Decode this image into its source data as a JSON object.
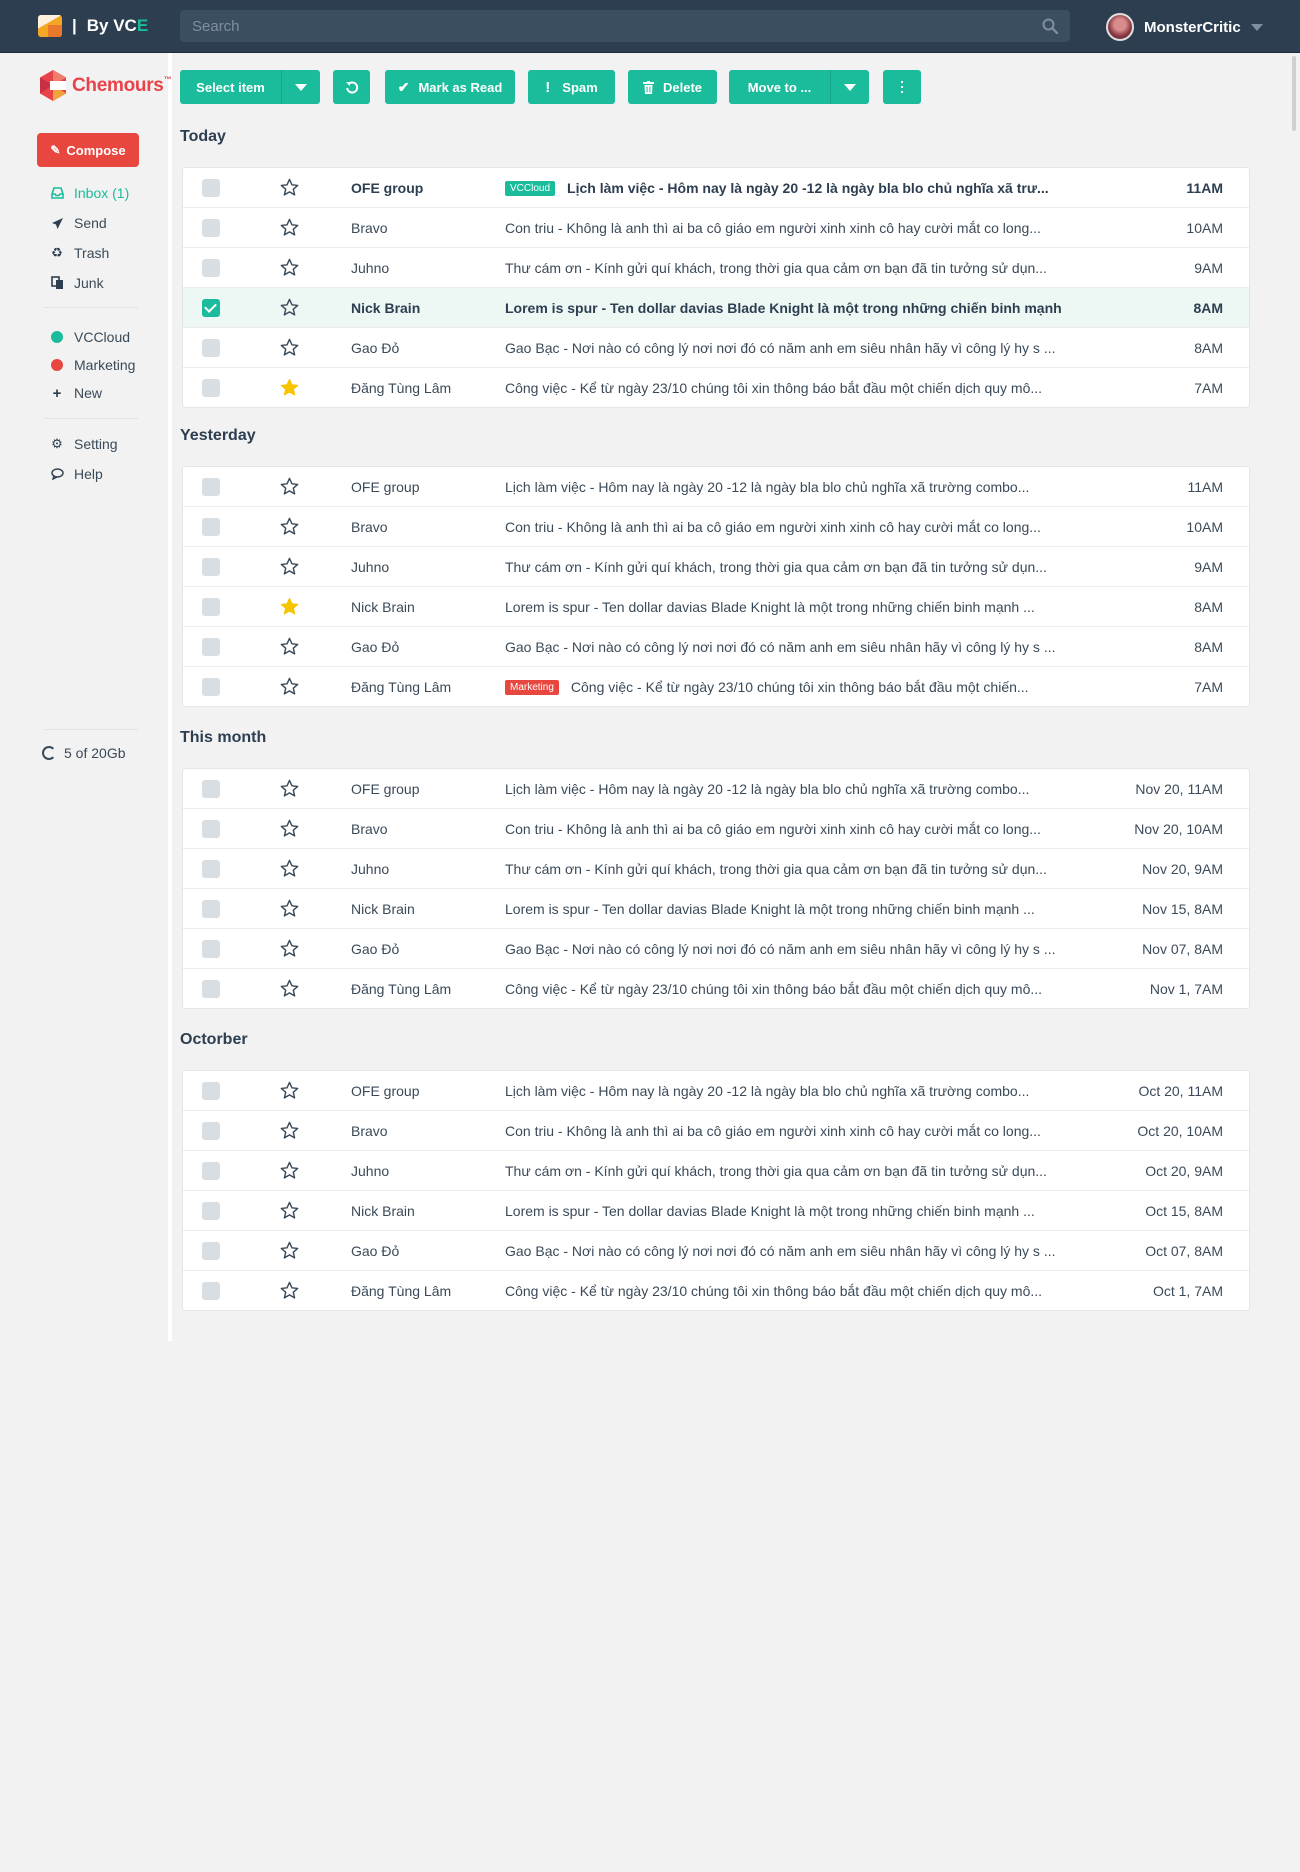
{
  "header": {
    "brand_sep": "|",
    "brand_text": "By VC",
    "brand_accent": "E",
    "search_placeholder": "Search",
    "user_name": "MonsterCritic"
  },
  "sidebar": {
    "brand_name": "Chemours",
    "brand_tm": "™",
    "compose_label": "Compose",
    "folders": [
      {
        "label": "Inbox (1)",
        "icon": "inbox-icon"
      },
      {
        "label": "Send",
        "icon": "send-icon"
      },
      {
        "label": "Trash",
        "icon": "recycle-icon"
      },
      {
        "label": "Junk",
        "icon": "junk-icon"
      }
    ],
    "labels": [
      {
        "label": "VCCloud",
        "color": "#1abc9c"
      },
      {
        "label": "Marketing",
        "color": "#e8473f"
      }
    ],
    "new_label": "New",
    "settings": [
      {
        "label": "Setting",
        "icon": "gear-icon"
      },
      {
        "label": "Help",
        "icon": "chat-icon"
      }
    ],
    "storage": "5 of 20Gb"
  },
  "toolbar": {
    "select_item": "Select item",
    "mark_as_read": "Mark as Read",
    "spam": "Spam",
    "delete": "Delete",
    "move_to": "Move to ..."
  },
  "colors": {
    "accent": "#1abc9c",
    "danger": "#e8473f",
    "topbar": "#2c3e50"
  },
  "groups": [
    {
      "title": "Today",
      "rows": [
        {
          "sender": "OFE group",
          "tag": "VCCloud",
          "tag_color": "#1abc9c",
          "subject": "Lịch làm việc - Hôm nay là ngày  20 -12 là ngày bla blo chủ nghĩa xã trư...",
          "time": "11AM",
          "unread": true,
          "starred": false,
          "checked": false
        },
        {
          "sender": "Bravo",
          "tag": "",
          "subject": "Con triu - Không là anh thì ai ba cô giáo em người xinh xinh cô hay cười mắt co long...",
          "time": "10AM",
          "unread": false,
          "starred": false,
          "checked": false
        },
        {
          "sender": "Juhno",
          "tag": "",
          "subject": "Thư cám ơn - Kính gửi quí khách, trong thời gia qua cảm ơn bạn đã tin tưởng sử dụn...",
          "time": "9AM",
          "unread": false,
          "starred": false,
          "checked": false
        },
        {
          "sender": "Nick Brain",
          "tag": "",
          "subject": "Lorem is spur - Ten dollar davias Blade Knight là một trong những chiến binh mạnh ...",
          "time": "8AM",
          "unread": true,
          "starred": false,
          "checked": true
        },
        {
          "sender": "Gao Đỏ",
          "tag": "",
          "subject": "Gao Bạc - Nơi nào có công lý nơi nơi đó có năm anh em siêu nhân hãy vì công lý hy s ...",
          "time": "8AM",
          "unread": false,
          "starred": false,
          "checked": false
        },
        {
          "sender": "Đăng Tùng Lâm",
          "tag": "",
          "subject": "Công việc - Kể từ ngày 23/10 chúng tôi xin thông báo bắt đầu một chiến dịch quy mô...",
          "time": "7AM",
          "unread": false,
          "starred": true,
          "checked": false
        }
      ]
    },
    {
      "title": "Yesterday",
      "rows": [
        {
          "sender": "OFE group",
          "tag": "",
          "subject": "Lịch làm việc - Hôm nay là ngày  20 -12 là ngày bla blo chủ nghĩa xã trường combo...",
          "time": "11AM",
          "unread": false,
          "starred": false,
          "checked": false
        },
        {
          "sender": "Bravo",
          "tag": "",
          "subject": "Con triu - Không là anh thì ai ba cô giáo em người xinh xinh cô hay cười mắt co long...",
          "time": "10AM",
          "unread": false,
          "starred": false,
          "checked": false
        },
        {
          "sender": "Juhno",
          "tag": "",
          "subject": "Thư cám ơn - Kính gửi quí khách, trong thời gia qua cảm ơn bạn đã tin tưởng sử dụn...",
          "time": "9AM",
          "unread": false,
          "starred": false,
          "checked": false
        },
        {
          "sender": "Nick Brain",
          "tag": "",
          "subject": "Lorem is spur - Ten dollar davias Blade Knight là một trong những chiến binh mạnh ...",
          "time": "8AM",
          "unread": false,
          "starred": true,
          "checked": false
        },
        {
          "sender": "Gao Đỏ",
          "tag": "",
          "subject": "Gao Bạc - Nơi nào có công lý nơi nơi đó có năm anh em siêu nhân hãy vì công lý hy s ...",
          "time": "8AM",
          "unread": false,
          "starred": false,
          "checked": false
        },
        {
          "sender": "Đăng Tùng Lâm",
          "tag": "Marketing",
          "tag_color": "#e8473f",
          "subject": "Công việc - Kể từ ngày 23/10 chúng tôi xin thông báo bắt đầu một chiến...",
          "time": "7AM",
          "unread": false,
          "starred": false,
          "checked": false
        }
      ]
    },
    {
      "title": "This month",
      "rows": [
        {
          "sender": "OFE group",
          "tag": "",
          "subject": "Lịch làm việc - Hôm nay là ngày  20 -12 là ngày bla blo chủ nghĩa xã trường combo...",
          "time": "Nov 20, 11AM",
          "unread": false,
          "starred": false,
          "checked": false
        },
        {
          "sender": "Bravo",
          "tag": "",
          "subject": "Con triu - Không là anh thì ai ba cô giáo em người xinh xinh cô hay cười mắt co long...",
          "time": "Nov 20, 10AM",
          "unread": false,
          "starred": false,
          "checked": false
        },
        {
          "sender": "Juhno",
          "tag": "",
          "subject": "Thư cám ơn - Kính gửi quí khách, trong thời gia qua cảm ơn bạn đã tin tưởng sử dụn...",
          "time": "Nov 20, 9AM",
          "unread": false,
          "starred": false,
          "checked": false
        },
        {
          "sender": "Nick Brain",
          "tag": "",
          "subject": "Lorem is spur - Ten dollar davias Blade Knight là một trong những chiến binh mạnh ...",
          "time": "Nov 15, 8AM",
          "unread": false,
          "starred": false,
          "checked": false
        },
        {
          "sender": "Gao Đỏ",
          "tag": "",
          "subject": "Gao Bạc - Nơi nào có công lý nơi nơi đó có năm anh em siêu nhân hãy vì công lý hy s ...",
          "time": "Nov 07, 8AM",
          "unread": false,
          "starred": false,
          "checked": false
        },
        {
          "sender": "Đăng Tùng Lâm",
          "tag": "",
          "subject": "Công việc - Kể từ ngày 23/10 chúng tôi xin thông báo bắt đầu một chiến dịch quy mô...",
          "time": "Nov 1, 7AM",
          "unread": false,
          "starred": false,
          "checked": false
        }
      ]
    },
    {
      "title": "Octorber",
      "rows": [
        {
          "sender": "OFE group",
          "tag": "",
          "subject": "Lịch làm việc - Hôm nay là ngày  20 -12 là ngày bla blo chủ nghĩa xã trường combo...",
          "time": "Oct 20, 11AM",
          "unread": false,
          "starred": false,
          "checked": false
        },
        {
          "sender": "Bravo",
          "tag": "",
          "subject": "Con triu - Không là anh thì ai ba cô giáo em người xinh xinh cô hay cười mắt co long...",
          "time": "Oct 20, 10AM",
          "unread": false,
          "starred": false,
          "checked": false
        },
        {
          "sender": "Juhno",
          "tag": "",
          "subject": "Thư cám ơn - Kính gửi quí khách, trong thời gia qua cảm ơn bạn đã tin tưởng sử dụn...",
          "time": "Oct 20, 9AM",
          "unread": false,
          "starred": false,
          "checked": false
        },
        {
          "sender": "Nick Brain",
          "tag": "",
          "subject": "Lorem is spur - Ten dollar davias Blade Knight là một trong những chiến binh mạnh ...",
          "time": "Oct 15, 8AM",
          "unread": false,
          "starred": false,
          "checked": false
        },
        {
          "sender": "Gao Đỏ",
          "tag": "",
          "subject": "Gao Bạc - Nơi nào có công lý nơi nơi đó có năm anh em siêu nhân hãy vì công lý hy s ...",
          "time": "Oct 07, 8AM",
          "unread": false,
          "starred": false,
          "checked": false
        },
        {
          "sender": "Đăng Tùng Lâm",
          "tag": "",
          "subject": "Công việc - Kể từ ngày 23/10 chúng tôi xin thông báo bắt đầu một chiến dịch quy mô...",
          "time": "Oct 1, 7AM",
          "unread": false,
          "starred": false,
          "checked": false
        }
      ]
    }
  ]
}
